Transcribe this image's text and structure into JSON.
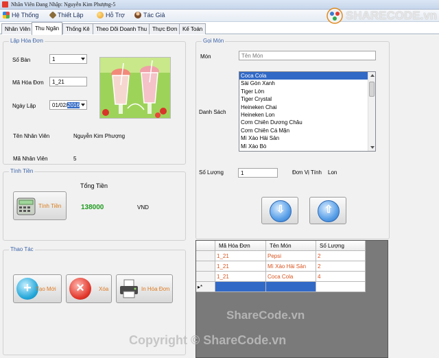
{
  "window": {
    "title": "Nhân Viên Đang Nhập: Nguyễn Kim Phượng-5"
  },
  "menu": [
    {
      "label": "Hệ Thống",
      "icon": "windows-flag-icon"
    },
    {
      "label": "Thiết Lập",
      "icon": "tools-icon"
    },
    {
      "label": "Hỗ Trợ",
      "icon": "help-globe-icon"
    },
    {
      "label": "Tác Giả",
      "icon": "person-icon"
    }
  ],
  "tabs": [
    "Nhân Viên",
    "Thu Ngân",
    "Thống Kê",
    "Theo Dõi Doanh Thu",
    "Thực Đơn",
    "Kế Toán"
  ],
  "active_tab": "Thu Ngân",
  "invoice": {
    "group_title": "Lập Hóa Đơn",
    "table_no_label": "Số Bàn",
    "table_no_value": "1",
    "invoice_id_label": "Mã Hóa Đơn",
    "invoice_id_value": "1_21",
    "date_label": "Ngày Lập",
    "date_prefix": "01/02/",
    "date_selected": "2016",
    "employee_name_label": "Tên Nhân Viên",
    "employee_name_value": "Nguyễn Kim Phượng",
    "employee_id_label": "Mã Nhân Viên",
    "employee_id_value": "5"
  },
  "payment": {
    "group_title": "Tính Tiền",
    "total_label": "Tổng Tiền",
    "total_value": "138000",
    "currency": "VND",
    "calc_button": "Tính Tiền"
  },
  "actions": {
    "group_title": "Thao Tác",
    "new_button": "Tạo Mới",
    "delete_button": "Xóa",
    "print_button": "In Hóa Đơn"
  },
  "order": {
    "group_title": "Gọi Món",
    "dish_label": "Món",
    "dish_placeholder": "Tên Món",
    "list_label": "Danh Sách",
    "menu_items": [
      "Coca Cola",
      "Sài Gòn Xanh",
      "Tiger Lớn",
      "Tiger Crystal",
      "Heineken Chai",
      "Heineken Lon",
      "Cơm Chiên Dương Châu",
      "Cơm Chiên Cá Mặn",
      "Mì Xào Hải Sản",
      "Mì Xào Bò"
    ],
    "selected_item": "Coca Cola",
    "quantity_label": "Số Lượng",
    "quantity_value": "1",
    "unit_label": "Đơn Vị Tính",
    "unit_value": "Lon"
  },
  "grid": {
    "columns": [
      "Mã Hóa Đơn",
      "Tên Món",
      "Số Lượng"
    ],
    "rows": [
      [
        "1_21",
        "Pepsi",
        "2"
      ],
      [
        "1_21",
        "Mì Xào Hải Sản",
        "2"
      ],
      [
        "1_21",
        "Coca Cola",
        "4"
      ]
    ],
    "new_row_marker": "▸*"
  },
  "watermark": {
    "logo_text": "SHARECODE.vn",
    "mid_text": "ShareCode.vn",
    "copyright": "Copyright © ShareCode.vn"
  },
  "colors": {
    "accent_blue": "#3169c6",
    "group_title": "#3a62a8",
    "total_green": "#1f9a1f",
    "orange_text": "#d97b1a"
  }
}
